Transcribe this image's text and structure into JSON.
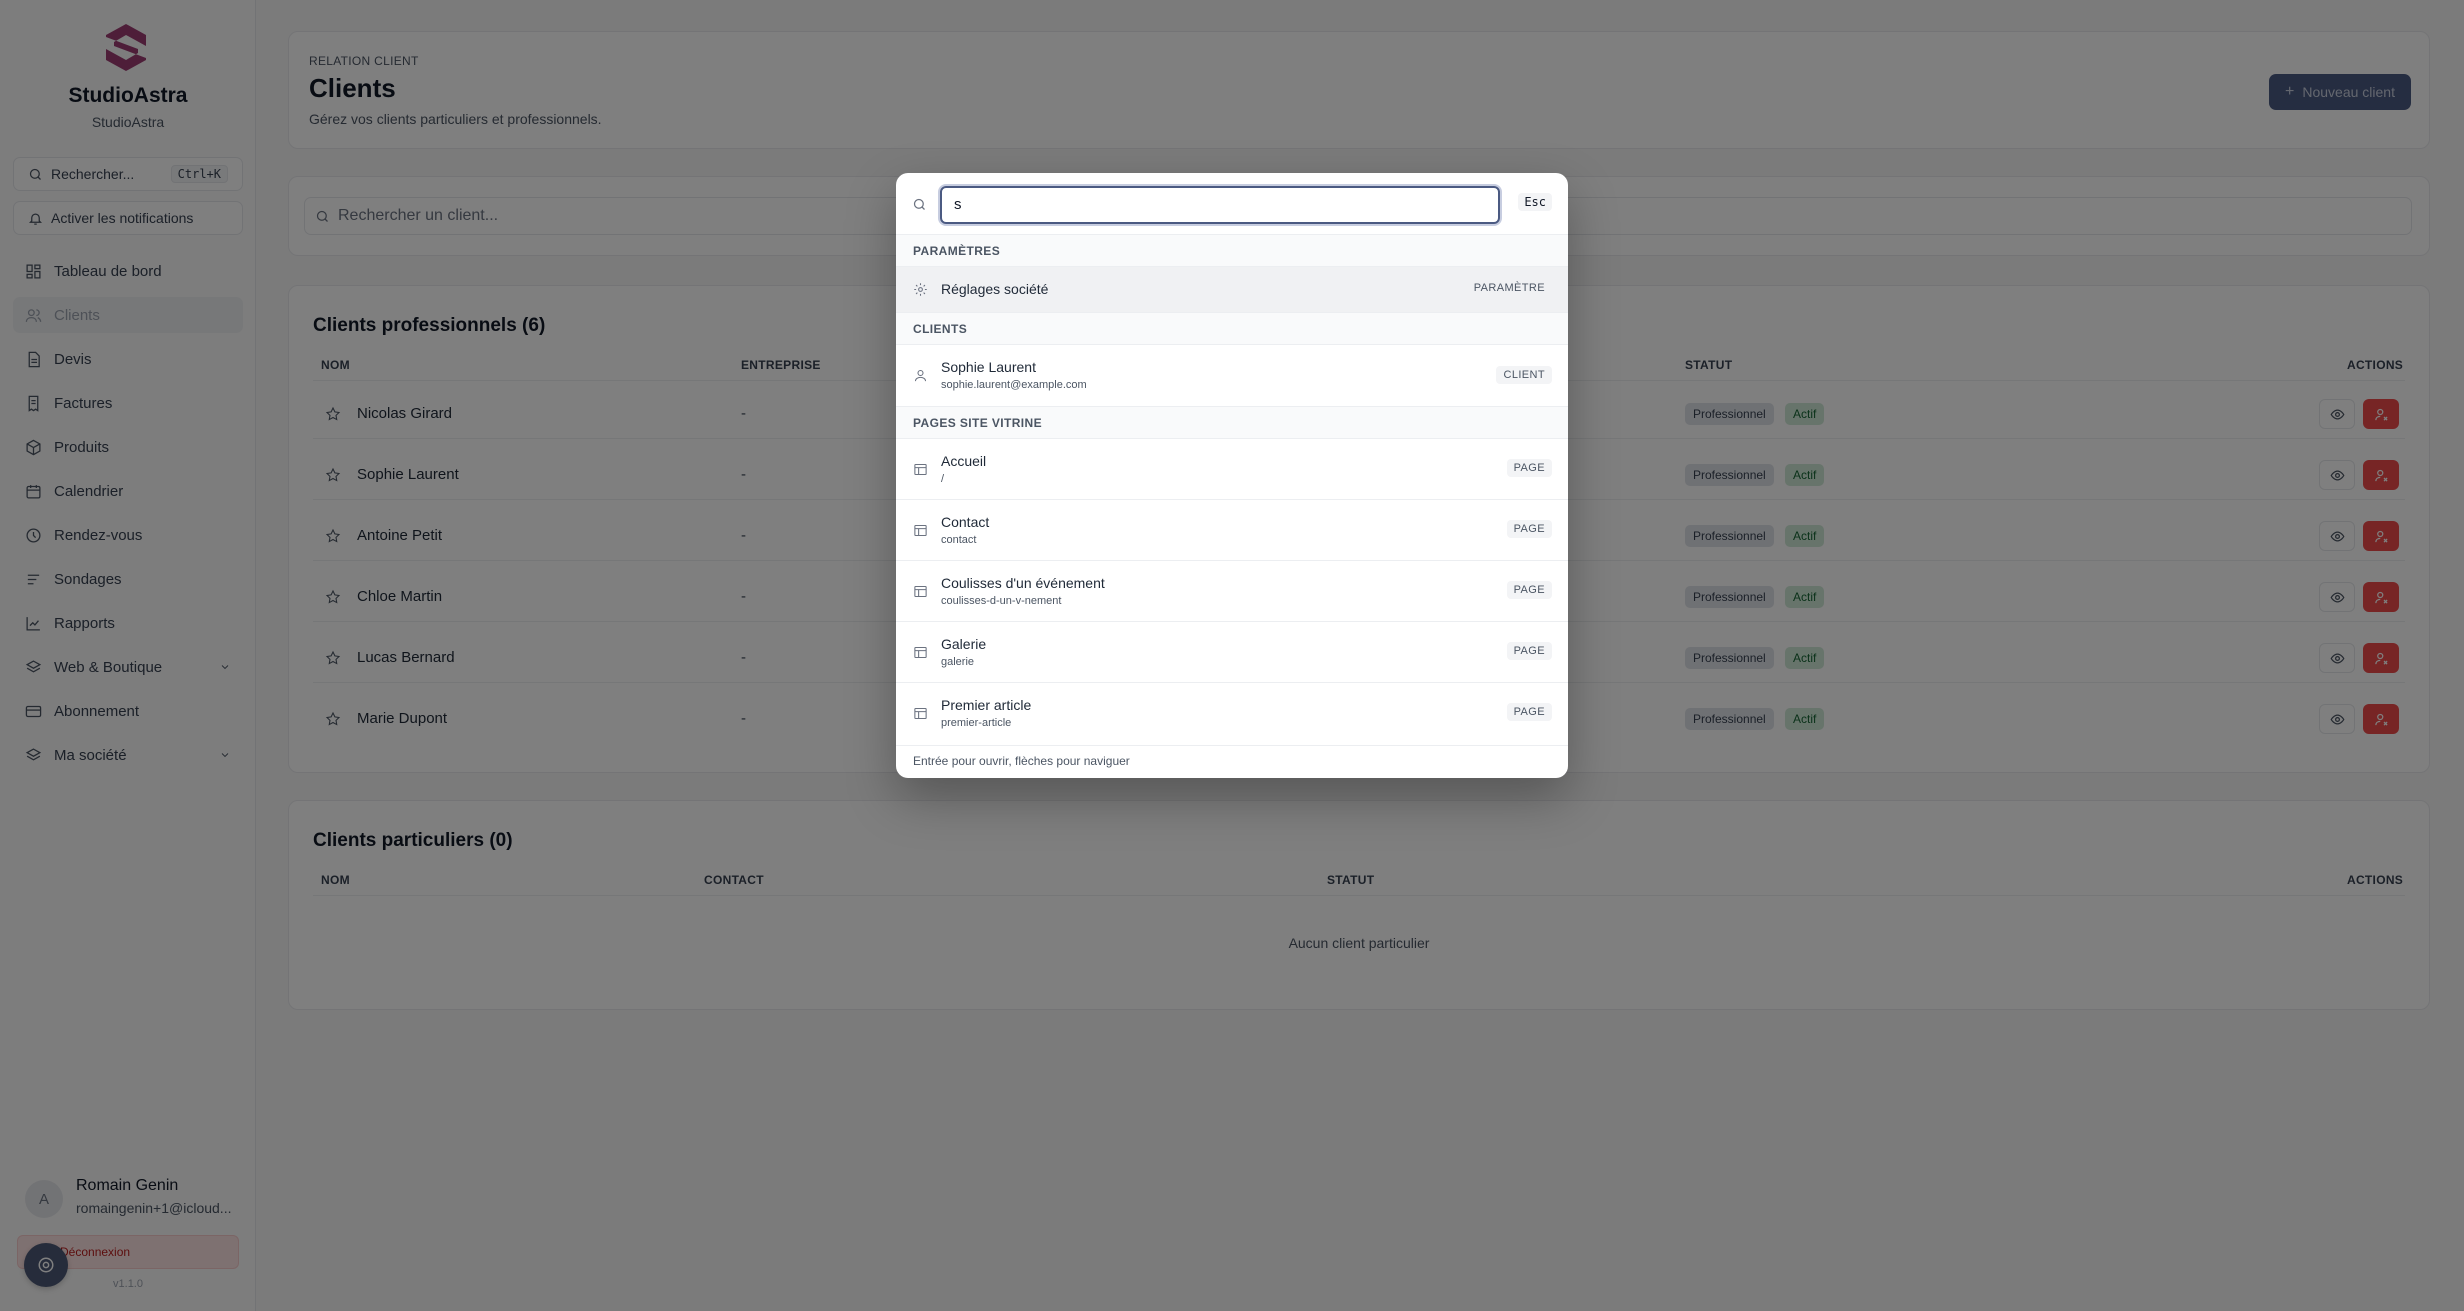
{
  "sidebar": {
    "brand_name": "StudioAstra",
    "brand_sub": "StudioAstra",
    "search_label": "Rechercher...",
    "search_shortcut": "Ctrl+K",
    "notifications_label": "Activer les notifications",
    "items": [
      {
        "label": "Tableau de bord",
        "icon": "dashboard-icon"
      },
      {
        "label": "Clients",
        "icon": "users-icon"
      },
      {
        "label": "Devis",
        "icon": "document-icon"
      },
      {
        "label": "Factures",
        "icon": "invoice-icon"
      },
      {
        "label": "Produits",
        "icon": "box-icon"
      },
      {
        "label": "Calendrier",
        "icon": "calendar-icon"
      },
      {
        "label": "Rendez-vous",
        "icon": "clock-icon"
      },
      {
        "label": "Sondages",
        "icon": "list-icon"
      },
      {
        "label": "Rapports",
        "icon": "chart-icon"
      },
      {
        "label": "Web & Boutique",
        "icon": "layers-icon"
      },
      {
        "label": "Abonnement",
        "icon": "card-icon"
      },
      {
        "label": "Ma société",
        "icon": "layers-icon"
      }
    ],
    "user": {
      "initial": "A",
      "name": "Romain Genin",
      "email": "romaingenin+1@icloud..."
    },
    "logout_label": "Déconnexion",
    "version": "v1.1.0"
  },
  "header": {
    "eyebrow": "RELATION CLIENT",
    "title": "Clients",
    "subtitle": "Gérez vos clients particuliers et professionnels.",
    "new_button": "Nouveau client"
  },
  "client_search": {
    "placeholder": "Rechercher un client..."
  },
  "pro_section": {
    "title": "Clients professionnels (6)",
    "columns": {
      "name": "NOM",
      "company": "ENTREPRISE",
      "status": "STATUT",
      "actions": "ACTIONS"
    },
    "rows": [
      {
        "name": "Nicolas Girard",
        "company": "-",
        "type": "Professionnel",
        "status": "Actif"
      },
      {
        "name": "Sophie Laurent",
        "company": "-",
        "type": "Professionnel",
        "status": "Actif"
      },
      {
        "name": "Antoine Petit",
        "company": "-",
        "type": "Professionnel",
        "status": "Actif"
      },
      {
        "name": "Chloe Martin",
        "company": "-",
        "type": "Professionnel",
        "status": "Actif"
      },
      {
        "name": "Lucas Bernard",
        "company": "-",
        "type": "Professionnel",
        "status": "Actif"
      },
      {
        "name": "Marie Dupont",
        "company": "-",
        "type": "Professionnel",
        "status": "Actif"
      }
    ]
  },
  "part_section": {
    "title": "Clients particuliers (0)",
    "columns": {
      "name": "NOM",
      "contact": "CONTACT",
      "status": "STATUT",
      "actions": "ACTIONS"
    },
    "empty": "Aucun client particulier"
  },
  "palette": {
    "query": "s",
    "esc": "Esc",
    "groups": [
      {
        "label": "PARAMÈTRES",
        "items": [
          {
            "title": "Réglages société",
            "sub": "",
            "tag": "PARAMÈTRE",
            "icon": "gear-icon"
          }
        ]
      },
      {
        "label": "CLIENTS",
        "items": [
          {
            "title": "Sophie Laurent",
            "sub": "sophie.laurent@example.com",
            "tag": "CLIENT",
            "icon": "user-icon"
          }
        ]
      },
      {
        "label": "PAGES SITE VITRINE",
        "items": [
          {
            "title": "Accueil",
            "sub": "/",
            "tag": "PAGE",
            "icon": "page-icon"
          },
          {
            "title": "Contact",
            "sub": "contact",
            "tag": "PAGE",
            "icon": "page-icon"
          },
          {
            "title": "Coulisses d'un événement",
            "sub": "coulisses-d-un-v-nement",
            "tag": "PAGE",
            "icon": "page-icon"
          },
          {
            "title": "Galerie",
            "sub": "galerie",
            "tag": "PAGE",
            "icon": "page-icon"
          },
          {
            "title": "Premier article",
            "sub": "premier-article",
            "tag": "PAGE",
            "icon": "page-icon"
          }
        ]
      }
    ],
    "footer": "Entrée pour ouvrir, flèches pour naviguer"
  },
  "colors": {
    "accent": "#4b5a82",
    "danger": "#ee4a4a",
    "active_badge": "#cfe8d6"
  }
}
